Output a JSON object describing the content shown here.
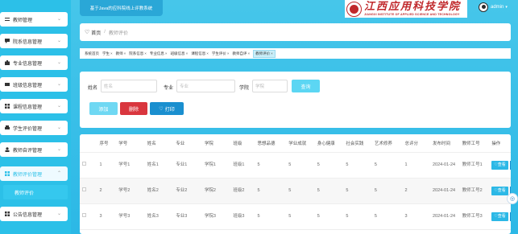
{
  "sidebar": {
    "items": [
      {
        "label": "教师管理",
        "icon": "sliders-icon"
      },
      {
        "label": "院系信息管理",
        "icon": "comment-icon"
      },
      {
        "label": "专业信息管理",
        "icon": "briefcase-icon"
      },
      {
        "label": "班级信息管理",
        "icon": "id-card-icon"
      },
      {
        "label": "课程信息管理",
        "icon": "grid-icon"
      },
      {
        "label": "学生评价管理",
        "icon": "printer-icon"
      },
      {
        "label": "教师自评管理",
        "icon": "user-icon"
      },
      {
        "label": "教师评价管理",
        "icon": "grid-icon"
      },
      {
        "label": "公告信息管理",
        "icon": "grid-icon"
      }
    ],
    "active_sub": "教师评价"
  },
  "header": {
    "title": "基于Java的应科院线上评教系统",
    "logo_text": "江西应用科技学院",
    "logo_en": "JIANGXI INSTITUTE OF APPLIED SCIENCE AND TECHNOLOGY",
    "user": "admin"
  },
  "breadcrumb": {
    "home": "首页",
    "current": "教师评价"
  },
  "tags": [
    "系统首页",
    "学生",
    "教师",
    "院系信息",
    "专业信息",
    "班级信息",
    "课程信息",
    "学生评价",
    "教师自评",
    "教师评价"
  ],
  "search": {
    "name_label": "姓名",
    "name_placeholder": "姓名",
    "major_label": "专业",
    "major_placeholder": "专业",
    "college_label": "学院",
    "college_placeholder": "学院",
    "query_btn": "查询",
    "add_btn": "添加",
    "delete_btn": "删除",
    "print_btn": "打印"
  },
  "table": {
    "headers": [
      "序号",
      "学号",
      "姓名",
      "专业",
      "学院",
      "班级",
      "思想品德",
      "学业成就",
      "身心健康",
      "社会实践",
      "艺术修养",
      "总评分",
      "发布时间",
      "教师工号",
      "操作"
    ],
    "rows": [
      [
        "1",
        "学号1",
        "姓名1",
        "专业1",
        "学院1",
        "班级1",
        "5",
        "5",
        "5",
        "5",
        "5",
        "1",
        "2024-01-24",
        "教师工号1"
      ],
      [
        "2",
        "学号2",
        "姓名2",
        "专业2",
        "学院2",
        "班级2",
        "5",
        "5",
        "5",
        "5",
        "5",
        "2",
        "2024-01-24",
        "教师工号2"
      ],
      [
        "3",
        "学号3",
        "姓名3",
        "专业3",
        "学院3",
        "班级3",
        "5",
        "5",
        "5",
        "5",
        "5",
        "3",
        "2024-01-24",
        "教师工号3"
      ]
    ],
    "view_label": "查看"
  },
  "colors": {
    "accent": "#2cb8e6",
    "danger": "#d9363e",
    "print": "#1a8fcf"
  }
}
